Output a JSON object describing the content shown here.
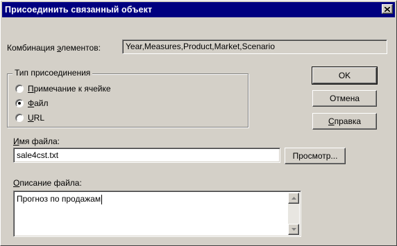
{
  "window": {
    "title": "Присоединить связанный объект"
  },
  "combination": {
    "label_pre": "Комбинация ",
    "label_accel": "э",
    "label_post": "лементов:",
    "value": "Year,Measures,Product,Market,Scenario"
  },
  "attach_type": {
    "caption": "Тип присоединения",
    "options": [
      {
        "accel": "П",
        "rest": "римечание к ячейке",
        "selected": false
      },
      {
        "accel": "Ф",
        "rest": "айл",
        "selected": true
      },
      {
        "accel": "U",
        "rest": "RL",
        "selected": false
      }
    ]
  },
  "buttons": {
    "ok": "OK",
    "cancel": "Отмена",
    "help_accel": "С",
    "help_rest": "правка",
    "browse": "Просмотр..."
  },
  "file_name": {
    "label_accel": "И",
    "label_rest": "мя файла:",
    "value": "sale4cst.txt"
  },
  "file_description": {
    "label_accel": "О",
    "label_rest": "писание файла:",
    "value": "Прогноз по продажам"
  },
  "icons": {
    "close": "close-icon",
    "scroll_up": "arrow-up-icon",
    "scroll_down": "arrow-down-icon"
  }
}
